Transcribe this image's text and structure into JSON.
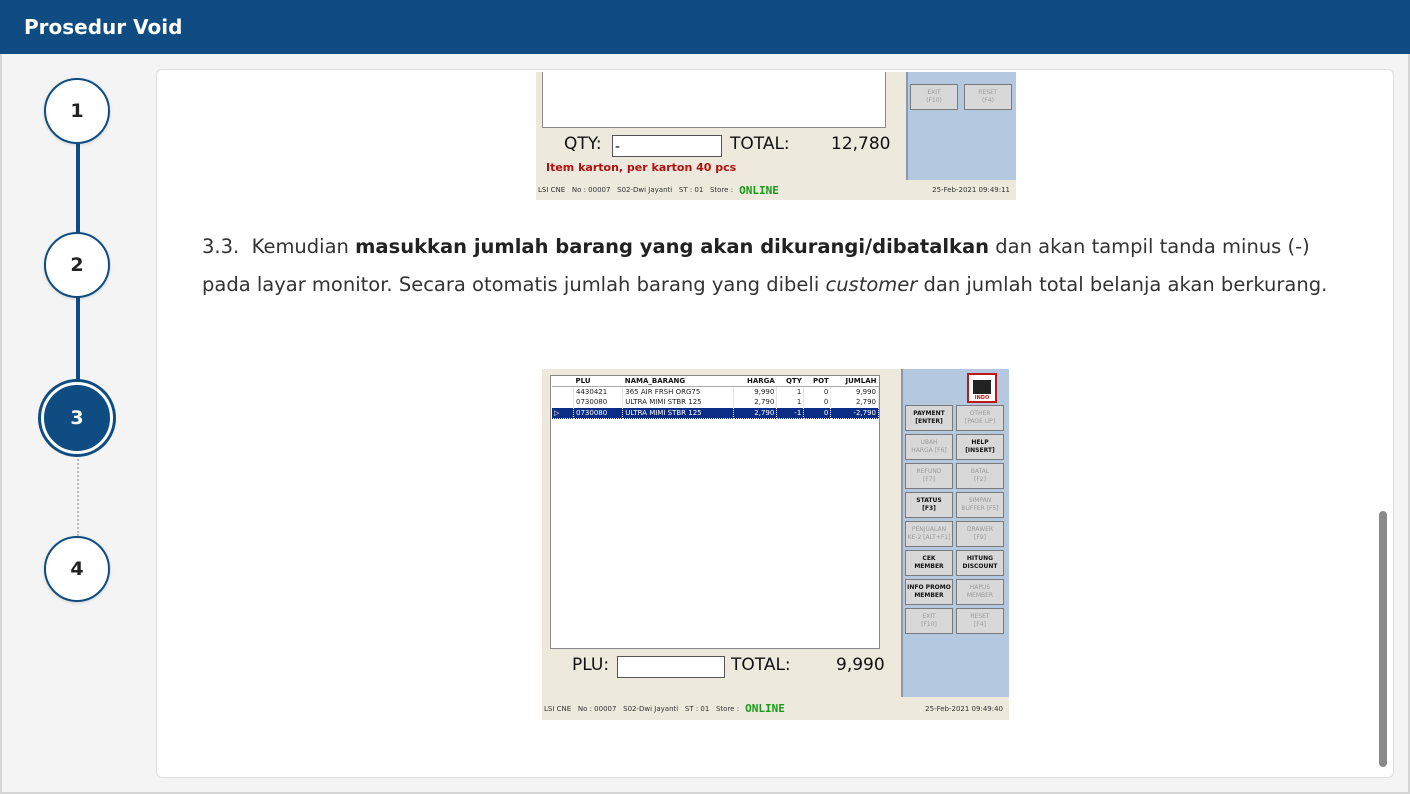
{
  "header": {
    "title": "Prosedur Void"
  },
  "steps": [
    "1",
    "2",
    "3",
    "4"
  ],
  "active_step": 3,
  "content": {
    "para_num": "3.3.",
    "para_part1": "Kemudian ",
    "para_bold": "masukkan jumlah barang yang akan dikurangi/dibatalkan",
    "para_part2": " dan akan tampil tanda minus (-) pada layar monitor. Secara otomatis jumlah barang yang dibeli ",
    "para_italic": "customer",
    "para_part3": " dan jumlah total belanja akan berkurang."
  },
  "pos_top": {
    "btn_exit": "EXIT\n(F10)",
    "btn_reset": "RESET\n(F4)",
    "qty_label": "QTY:",
    "qty_value": "-",
    "total_label": "TOTAL:",
    "total_value": "12,780",
    "note": "Item karton, per karton 40 pcs",
    "status_left": "LSI CNE   No : 00007   S02-Dwi Jayanti   ST : 01   Store :",
    "online": "ONLINE",
    "status_right": "25-Feb-2021 09:49:11"
  },
  "pos_bottom": {
    "columns": [
      "PLU",
      "NAMA_BARANG",
      "HARGA",
      "QTY",
      "POT",
      "JUMLAH"
    ],
    "rows": [
      [
        "4430421",
        "365 AIR FRSH ORG75",
        "9,990",
        "1",
        "0",
        "9,990"
      ],
      [
        "0730080",
        "ULTRA MIMI STBR 125",
        "2,790",
        "1",
        "0",
        "2,790"
      ],
      [
        "0730080",
        "ULTRA MIMI STBR 125",
        "2,790",
        "-1",
        "0",
        "-2,790"
      ]
    ],
    "logo_text": "INDO",
    "buttons": [
      {
        "label": "PAYMENT\n[ENTER]",
        "enabled": true
      },
      {
        "label": "OTHER\n[PAGE UP]",
        "enabled": false
      },
      {
        "label": "UBAH\nHARGA [F6]",
        "enabled": false
      },
      {
        "label": "HELP\n[INSERT]",
        "enabled": true
      },
      {
        "label": "REFUND\n[F7]",
        "enabled": false
      },
      {
        "label": "BATAL\n[F2]",
        "enabled": false
      },
      {
        "label": "STATUS\n[F3]",
        "enabled": true
      },
      {
        "label": "SIMPAN\nBUFFER [F5]",
        "enabled": false
      },
      {
        "label": "PENJUALAN\nKE-2 [ALT+F1]",
        "enabled": false
      },
      {
        "label": "DRAWER\n[F9]",
        "enabled": false
      },
      {
        "label": "CEK\nMEMBER",
        "enabled": true
      },
      {
        "label": "HITUNG\nDISCOUNT",
        "enabled": true
      },
      {
        "label": "INFO PROMO\nMEMBER",
        "enabled": true
      },
      {
        "label": "HAPUS\nMEMBER",
        "enabled": false
      },
      {
        "label": "EXIT\n[F10]",
        "enabled": false
      },
      {
        "label": "RESET\n[F4]",
        "enabled": false
      }
    ],
    "plu_label": "PLU:",
    "total_label": "TOTAL:",
    "total_value": "9,990",
    "status_left": "LSI CNE   No : 00007   S02-Dwi Jayanti   ST : 01   Store :",
    "online": "ONLINE",
    "status_right": "25-Feb-2021 09:49:40"
  }
}
